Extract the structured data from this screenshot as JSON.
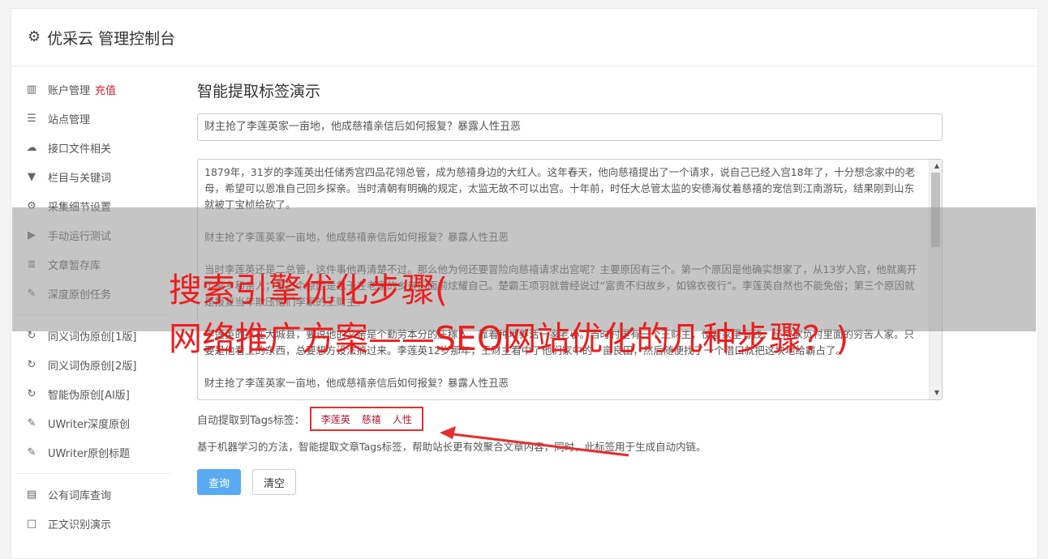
{
  "header": {
    "title": "优采云 管理控制台"
  },
  "sidebar": {
    "group1": [
      {
        "icon": "bar-chart-icon",
        "glyph": "▥",
        "label": "账户管理",
        "extra": "充值"
      },
      {
        "icon": "server-icon",
        "glyph": "☰",
        "label": "站点管理"
      },
      {
        "icon": "cloud-upload-icon",
        "glyph": "☁",
        "label": "接口文件相关"
      },
      {
        "icon": "filter-icon",
        "glyph": "▼",
        "label": "栏目与关键词"
      },
      {
        "icon": "cogs-icon",
        "glyph": "⚙",
        "label": "采集细节设置"
      },
      {
        "icon": "play-circle-icon",
        "glyph": "▶",
        "label": "手动运行测试"
      },
      {
        "icon": "database-icon",
        "glyph": "≣",
        "label": "文章暂存库"
      },
      {
        "icon": "edit-icon",
        "glyph": "✎",
        "label": "深度原创任务"
      }
    ],
    "group2": [
      {
        "icon": "refresh-icon",
        "glyph": "↻",
        "label": "同义词伪原创[1版]"
      },
      {
        "icon": "refresh-icon",
        "glyph": "↻",
        "label": "同义词伪原创[2版]"
      },
      {
        "icon": "refresh-icon",
        "glyph": "↻",
        "label": "智能伪原创[AI版]"
      },
      {
        "icon": "edit-icon",
        "glyph": "✎",
        "label": "UWriter深度原创"
      },
      {
        "icon": "edit-icon",
        "glyph": "✎",
        "label": "UWriter原创标题"
      }
    ],
    "group3": [
      {
        "icon": "book-icon",
        "glyph": "▤",
        "label": "公有词库查询"
      },
      {
        "icon": "square-icon",
        "glyph": "□",
        "label": "正文识别演示"
      }
    ]
  },
  "main": {
    "title": "智能提取标签演示",
    "title_input": "财主抢了李莲英家一亩地，他成慈禧亲信后如何报复？暴露人性丑恶",
    "content_paragraphs": [
      "1879年，31岁的李莲英出任储秀宫四品花翎总管，成为慈禧身边的大红人。这年春天，他向慈禧提出了一个请求，说自己已经入宫18年了，十分想念家中的老母，希望可以恩准自己回乡探亲。当时清朝有明确的规定，太监无故不可以出宫。十年前，时任大总管太监的安德海仗着慈禧的宠信到江南游玩，结果刚到山东就被丁宝桢给砍了。",
      "财主抢了李莲英家一亩地，他成慈禧亲信后如何报复？暴露人性丑恶",
      "当时李莲英还是二总管，这件事他再清楚不过。那么他为何还要冒险向慈禧请求出宫呢？主要原因有三个。第一个原因是他确实想家了，从13岁入宫，他就离开了家乡和亲人；第二个原因是急于在老家的乡亲们面前炫耀自己。楚霸王项羽就曾经说过“富贵不归故乡，如锦衣夜行”。李莲英自然也不能免俗；第三个原因就是报复当年欺压他们李家的王财主。",
      "李莲英的家在大城县，要说他的父亲是个勤劳本分的庄稼人，靠着种地养活一家老小。当时村里有一个王财主，仗着家里有钱，经常欺负村里面的穷苦人家。只要是他看上的东西，总要想方设法搞过来。李莲英12岁那年，王财主看中了他们家中的一亩良田，然后随便找了一个借口就把这块地给霸占了。",
      "财主抢了李莲英家一亩地，他成慈禧亲信后如何报复？暴露人性丑恶"
    ],
    "tags_label": "自动提取到Tags标签：",
    "tags": [
      "李莲英",
      "慈禧",
      "人性"
    ],
    "description": "基于机器学习的方法，智能提取文章Tags标签，帮助站长更有效聚合文章内容，同时，此标签用于生成自动内链。",
    "query_button": "查询",
    "clear_button": "清空"
  },
  "overlay": {
    "line1": "搜索引擎优化步骤(",
    "line2": "网络推广方案——SEO网站优化的几种步骤？)",
    "color": "#ee1c1c"
  }
}
